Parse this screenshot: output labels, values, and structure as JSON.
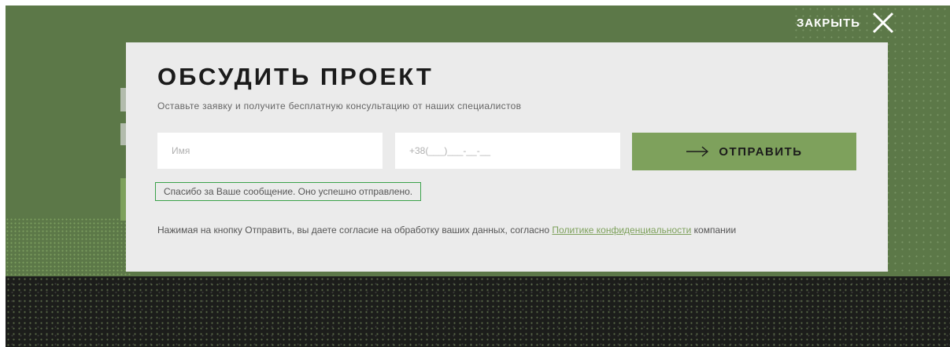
{
  "close": {
    "label": "ЗАКРЫТЬ",
    "icon": "close-icon"
  },
  "modal": {
    "title": "ОБСУДИТЬ ПРОЕКТ",
    "subtitle": "Оставьте заявку и получите бесплатную консультацию от наших специалистов",
    "name_field": {
      "placeholder": "Имя",
      "value": ""
    },
    "phone_field": {
      "placeholder": "+38(___)___-__-__",
      "value": ""
    },
    "submit": {
      "label": "ОТПРАВИТЬ",
      "icon": "arrow-right-icon"
    },
    "success_message": "Спасибо за Ваше сообщение. Оно успешно отправлено.",
    "consent": {
      "text_before": "Нажимая на кнопку Отправить, вы даете согласие на обработку ваших данных, согласно ",
      "link_text": "Политике конфиденциальности",
      "text_after": " компании"
    }
  },
  "colors": {
    "background_green": "#5c7848",
    "accent_green": "#7ea15c",
    "modal_bg": "#ebebeb",
    "success_border": "#3aa14a",
    "dark_bg": "#1c1d1b"
  }
}
